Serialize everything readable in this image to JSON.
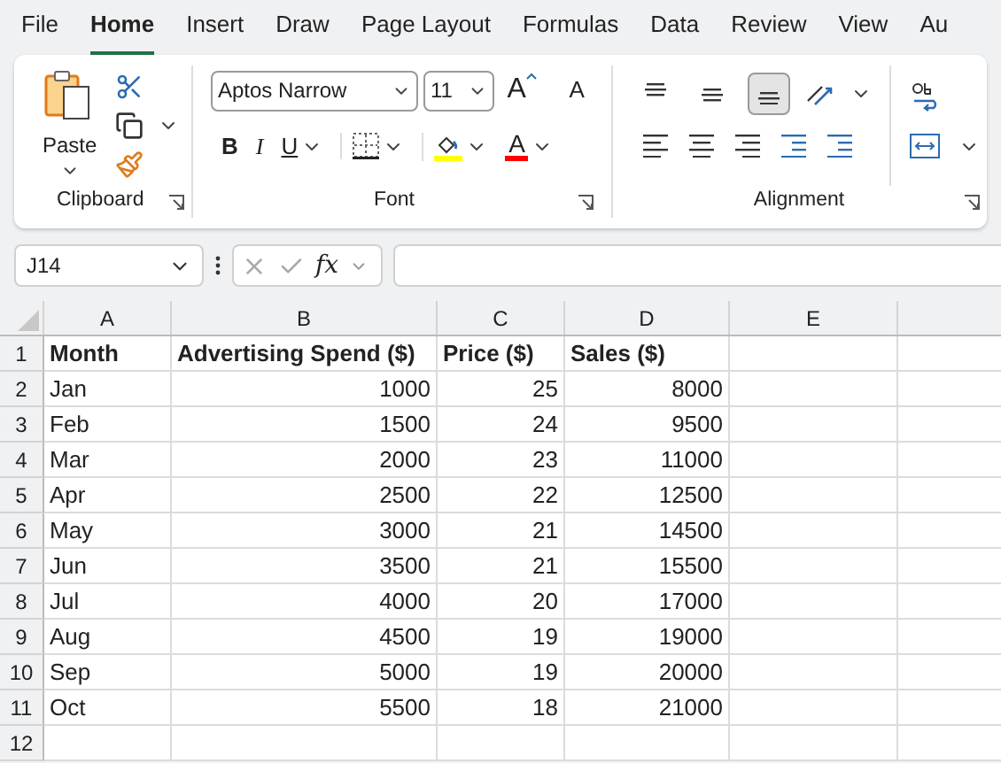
{
  "menu_tabs": [
    {
      "label": "File",
      "selected": false
    },
    {
      "label": "Home",
      "selected": true
    },
    {
      "label": "Insert",
      "selected": false
    },
    {
      "label": "Draw",
      "selected": false
    },
    {
      "label": "Page Layout",
      "selected": false
    },
    {
      "label": "Formulas",
      "selected": false
    },
    {
      "label": "Data",
      "selected": false
    },
    {
      "label": "Review",
      "selected": false
    },
    {
      "label": "View",
      "selected": false
    },
    {
      "label": "Au",
      "selected": false
    }
  ],
  "ribbon": {
    "clipboard": {
      "paste_label": "Paste",
      "group_label": "Clipboard"
    },
    "font": {
      "font_name": "Aptos Narrow",
      "font_size": "11",
      "grow_label": "A",
      "shrink_label": "A",
      "bold_label": "B",
      "italic_label": "I",
      "underline_label": "U",
      "font_color_label": "A",
      "group_label": "Font"
    },
    "alignment": {
      "group_label": "Alignment",
      "vertical_aligns": [
        {
          "selected": false
        },
        {
          "selected": false
        },
        {
          "selected": true
        }
      ]
    }
  },
  "formula_bar": {
    "name_box": "J14",
    "fx_label": "fx"
  },
  "sheet": {
    "column_headers": [
      "A",
      "B",
      "C",
      "D",
      "E"
    ],
    "row_numbers": [
      "1",
      "2",
      "3",
      "4",
      "5",
      "6",
      "7",
      "8",
      "9",
      "10",
      "11",
      "12"
    ],
    "rows": [
      {
        "kind": "header",
        "cells": [
          "Month",
          "Advertising Spend ($)",
          "Price ($)",
          "Sales ($)"
        ]
      },
      {
        "kind": "data",
        "cells": [
          "Jan",
          "1000",
          "25",
          "8000"
        ]
      },
      {
        "kind": "data",
        "cells": [
          "Feb",
          "1500",
          "24",
          "9500"
        ]
      },
      {
        "kind": "data",
        "cells": [
          "Mar",
          "2000",
          "23",
          "11000"
        ]
      },
      {
        "kind": "data",
        "cells": [
          "Apr",
          "2500",
          "22",
          "12500"
        ]
      },
      {
        "kind": "data",
        "cells": [
          "May",
          "3000",
          "21",
          "14500"
        ]
      },
      {
        "kind": "data",
        "cells": [
          "Jun",
          "3500",
          "21",
          "15500"
        ]
      },
      {
        "kind": "data",
        "cells": [
          "Jul",
          "4000",
          "20",
          "17000"
        ]
      },
      {
        "kind": "data",
        "cells": [
          "Aug",
          "4500",
          "19",
          "19000"
        ]
      },
      {
        "kind": "data",
        "cells": [
          "Sep",
          "5000",
          "19",
          "20000"
        ]
      },
      {
        "kind": "data",
        "cells": [
          "Oct",
          "5500",
          "18",
          "21000"
        ]
      }
    ]
  }
}
